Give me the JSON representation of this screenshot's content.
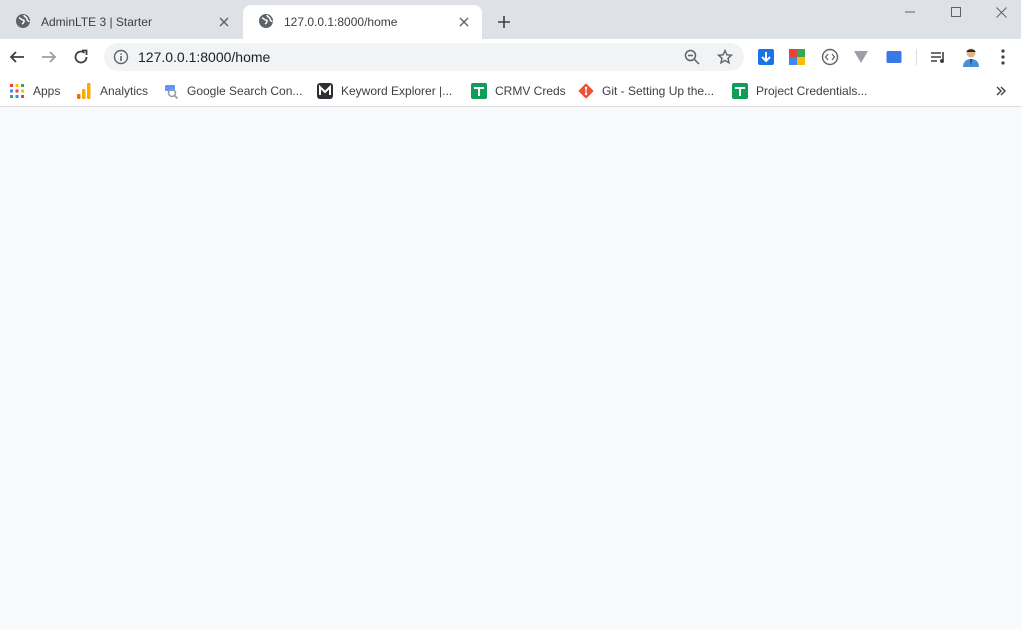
{
  "tabs": [
    {
      "title": "AdminLTE 3 | Starter",
      "active": false
    },
    {
      "title": "127.0.0.1:8000/home",
      "active": true
    }
  ],
  "address_bar": {
    "url": "127.0.0.1:8000/home"
  },
  "bookmarks": [
    {
      "label": "Apps",
      "icon": "apps-grid-icon"
    },
    {
      "label": "Analytics",
      "icon": "analytics-icon"
    },
    {
      "label": "Google Search Con...",
      "icon": "search-console-icon"
    },
    {
      "label": "Keyword Explorer |...",
      "icon": "keyword-explorer-icon"
    },
    {
      "label": "CRMV Creds",
      "icon": "sheets-icon"
    },
    {
      "label": "Git - Setting Up the...",
      "icon": "git-icon"
    },
    {
      "label": "Project Credentials...",
      "icon": "sheets-icon"
    }
  ],
  "colors": {
    "tabstrip": "#dee1e6",
    "page_background": "#f8f9fb",
    "download_ext": "#1a73e8",
    "git": "#f05133",
    "sheets": "#0f9d58",
    "analytics": "#f9ab00"
  }
}
